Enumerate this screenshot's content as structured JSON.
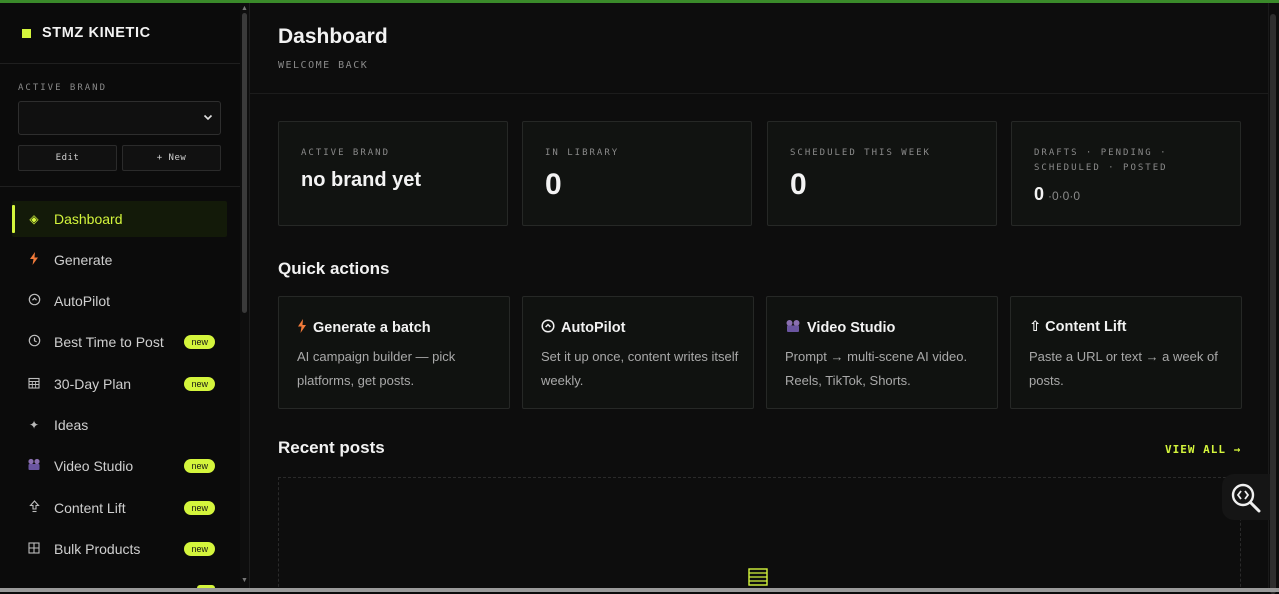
{
  "app": {
    "name": "STMZ KINETIC",
    "accent": "#d4f53c"
  },
  "sidebar": {
    "brand_label": "ACTIVE BRAND",
    "brand_select_value": "",
    "edit_label": "Edit",
    "new_label": "+ New",
    "items": [
      {
        "label": "Dashboard",
        "icon": "diamond-icon",
        "active": true
      },
      {
        "label": "Generate",
        "icon": "bolt-icon"
      },
      {
        "label": "AutoPilot",
        "icon": "autopilot-icon"
      },
      {
        "label": "Best Time to Post",
        "icon": "clock-icon",
        "badge": "new"
      },
      {
        "label": "30-Day Plan",
        "icon": "calendar-icon",
        "badge": "new"
      },
      {
        "label": "Ideas",
        "icon": "sparkle-icon"
      },
      {
        "label": "Video Studio",
        "icon": "video-icon",
        "badge": "new"
      },
      {
        "label": "Content Lift",
        "icon": "lift-icon",
        "badge": "new"
      },
      {
        "label": "Bulk Products",
        "icon": "grid-icon",
        "badge": "new"
      }
    ]
  },
  "header": {
    "title": "Dashboard",
    "subtitle": "WELCOME BACK"
  },
  "stats": [
    {
      "label": "ACTIVE BRAND",
      "value": "no brand yet"
    },
    {
      "label": "IN LIBRARY",
      "value": "0"
    },
    {
      "label": "SCHEDULED THIS WEEK",
      "value": "0"
    },
    {
      "label": "DRAFTS · PENDING · SCHEDULED · POSTED",
      "value": "0",
      "breakdown": "·0·0·0"
    }
  ],
  "quick_actions": {
    "title": "Quick actions",
    "items": [
      {
        "title": "Generate a batch",
        "icon": "bolt-icon",
        "desc": "AI campaign builder — pick platforms, get posts."
      },
      {
        "title": "AutoPilot",
        "icon": "autopilot-icon",
        "desc": "Set it up once, content writes itself weekly."
      },
      {
        "title": "Video Studio",
        "icon": "video-icon",
        "desc": "Prompt → multi-scene AI video. Reels, TikTok, Shorts."
      },
      {
        "title": "⇧ Content Lift",
        "icon": "lift-icon",
        "desc": "Paste a URL or text → a week of posts."
      }
    ]
  },
  "recent_posts": {
    "title": "Recent posts",
    "view_all": "VIEW ALL →"
  }
}
